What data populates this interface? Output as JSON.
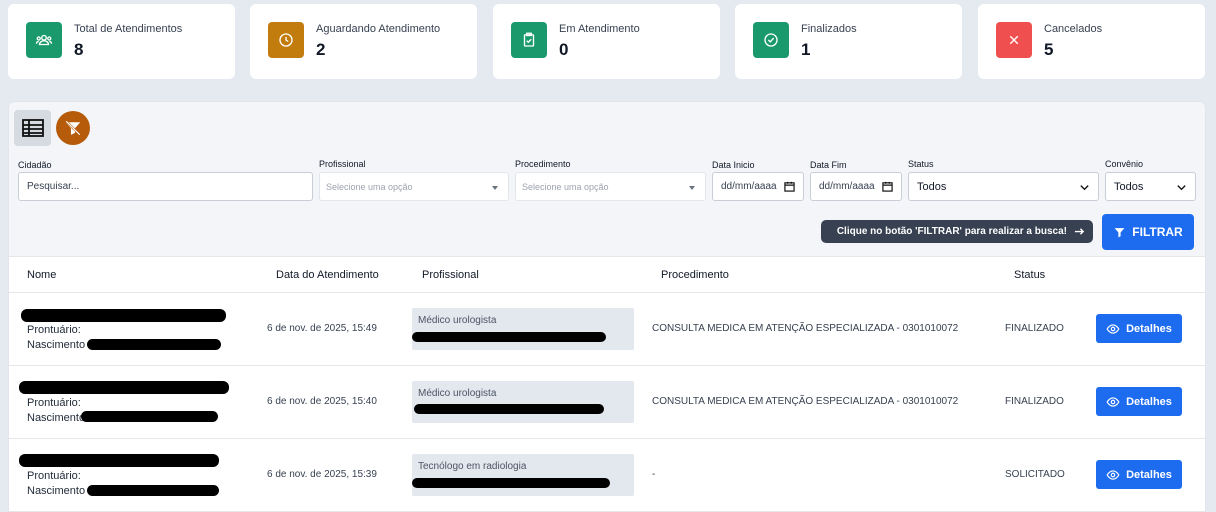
{
  "stats": [
    {
      "label": "Total de Atendimentos",
      "value": "8",
      "color": "#1a9a6c",
      "icon": "users-icon"
    },
    {
      "label": "Aguardando Atendimento",
      "value": "2",
      "color": "#c27c0e",
      "icon": "clock-icon"
    },
    {
      "label": "Em Atendimento",
      "value": "0",
      "color": "#1a9a6c",
      "icon": "clipboard-icon"
    },
    {
      "label": "Finalizados",
      "value": "1",
      "color": "#1a9a6c",
      "icon": "check-circle-icon"
    },
    {
      "label": "Cancelados",
      "value": "5",
      "color": "#ef4f4f",
      "icon": "close-icon"
    }
  ],
  "filters": {
    "cidadao_label": "Cidadão",
    "cidadao_placeholder": "Pesquisar...",
    "profissional_label": "Profissional",
    "profissional_value": "Selecione uma opção",
    "procedimento_label": "Procedimento",
    "procedimento_value": "Selecione uma opção",
    "data_inicio_label": "Data Inicio",
    "data_inicio_value": "dd/mm/aaaa",
    "data_fim_label": "Data Fim",
    "data_fim_value": "dd/mm/aaaa",
    "status_label": "Status",
    "status_value": "Todos",
    "convenio_label": "Convênio",
    "convenio_value": "Todos"
  },
  "hint": "Clique no botão 'FILTRAR' para realizar a busca!",
  "filter_button": "FILTRAR",
  "table": {
    "headers": [
      "Nome",
      "Data do Atendimento",
      "Profissional",
      "Procedimento",
      "Status"
    ],
    "rows": [
      {
        "prontuario": "Prontuário:",
        "nascimento": "Nascimento",
        "date": "6 de nov. de 2025, 15:49",
        "profissional": "Médico urologista",
        "procedimento": "CONSULTA MEDICA EM ATENÇÃO ESPECIALIZADA - 0301010072",
        "status": "FINALIZADO",
        "action": "Detalhes"
      },
      {
        "prontuario": "Prontuário:",
        "nascimento": "Nascimento",
        "date": "6 de nov. de 2025, 15:40",
        "profissional": "Médico urologista",
        "procedimento": "CONSULTA MEDICA EM ATENÇÃO ESPECIALIZADA - 0301010072",
        "status": "FINALIZADO",
        "action": "Detalhes"
      },
      {
        "prontuario": "Prontuário:",
        "nascimento": "Nascimento",
        "date": "6 de nov. de 2025, 15:39",
        "profissional": "Tecnólogo em radiologia",
        "procedimento": "-",
        "status": "SOLICITADO",
        "action": "Detalhes"
      }
    ]
  },
  "colors": {
    "primary": "#1d6cf0",
    "filter_off": "#b55b0a"
  }
}
